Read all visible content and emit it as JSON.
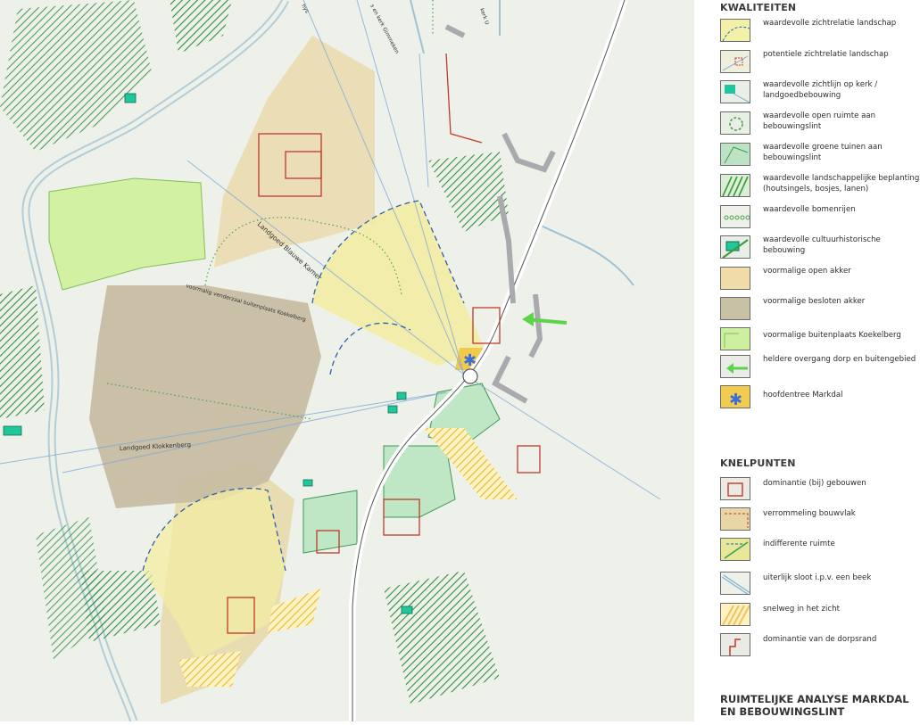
{
  "map": {
    "labels": {
      "landgoed_blauwe_kamer": "Landgoed Blauwe Kamer",
      "voormalig_venderzaal": "voormalig venderzaal buitenplaats Koekelberg",
      "landgoed_klokkenberg": "Landgoed Klokkenberg",
      "kerk_gimmeken": "s en kerk Gimmeken",
      "kerk_u": "kerk U",
      "hys": "hys"
    }
  },
  "legend": {
    "kwaliteiten": {
      "title": "KWALITEITEN",
      "items": [
        {
          "label": "waardevolle zichtrelatie landschap",
          "icon": "zichtrelatie-swatch",
          "color": "#f3f0a9"
        },
        {
          "label": "potentiele zichtrelatie landschap",
          "icon": "potentiele-zichtrelatie-swatch",
          "color": "#eef0dc"
        },
        {
          "label": "waardevolle zichtlijn op kerk / landgoedbebouwing",
          "icon": "zichtlijn-kerk-swatch",
          "color": "#20c4a0"
        },
        {
          "label": "waardevolle open ruimte aan bebouwingslint",
          "icon": "open-ruimte-swatch",
          "color": "#6fae4f"
        },
        {
          "label": "waardevolle groene tuinen aan bebouwingslint",
          "icon": "groene-tuinen-swatch",
          "color": "#bde3c4"
        },
        {
          "label": "waardevolle landschappelijke beplanting (houtsingels, bosjes, lanen)",
          "icon": "beplanting-swatch",
          "color": "#3a9a3a"
        },
        {
          "label": "waardevolle bomenrijen",
          "icon": "bomenrijen-swatch",
          "color": "#4aa04a"
        },
        {
          "label": "waardevolle cultuurhistorische bebouwing",
          "icon": "cultuurhistorische-bebouwing-swatch",
          "color": "#1fc79b"
        },
        {
          "label": "voormalige open akker",
          "icon": "open-akker-swatch",
          "color": "#f0dca8"
        },
        {
          "label": "voormalige besloten akker",
          "icon": "besloten-akker-swatch",
          "color": "#c9c1a6"
        },
        {
          "label": "voormalige buitenplaats Koekelberg",
          "icon": "buitenplaats-swatch",
          "color": "#cdf0a0"
        },
        {
          "label": "heldere overgang dorp en buitengebied",
          "icon": "overgang-arrow-swatch",
          "color": "#5bd44b"
        },
        {
          "label": "hoofdentree Markdal",
          "icon": "hoofdentree-star-swatch",
          "color": "#f0cc50"
        }
      ]
    },
    "knelpunten": {
      "title": "KNELPUNTEN",
      "items": [
        {
          "label": "dominantie (bij) gebouwen",
          "icon": "dominantie-gebouwen-swatch",
          "color": "#c0392b"
        },
        {
          "label": "verrommeling bouwvlak",
          "icon": "verrommeling-swatch",
          "color": "#e8d6a6"
        },
        {
          "label": "indifferente ruimte",
          "icon": "indifferente-ruimte-swatch",
          "color": "#e7e79a"
        },
        {
          "label": "uiterlijk sloot i.p.v. een beek",
          "icon": "sloot-swatch",
          "color": "#7fb4d4"
        },
        {
          "label": "snelweg in het zicht",
          "icon": "snelweg-swatch",
          "color": "#efc45a"
        },
        {
          "label": "dominantie van de dorpsrand",
          "icon": "dorpsrand-swatch",
          "color": "#c0392b"
        }
      ]
    },
    "bottom_title": "RUIMTELIJKE ANALYSE MARKDAL EN BEBOUWINGSLINT"
  }
}
